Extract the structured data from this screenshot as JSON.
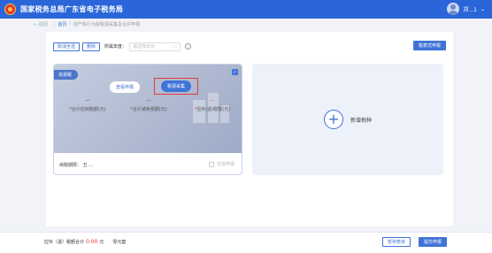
{
  "header": {
    "title": "国家税务总局广东省电子税务局",
    "user_name": "郑...1"
  },
  "breadcrumb": {
    "back": "← 返回",
    "home": "首页",
    "current": "财产和行为税税源采集及合并申报"
  },
  "toolbar": {
    "cancel_all": "取消全选",
    "delete": "删除",
    "period_label": "所属年度：",
    "period_placeholder": "请选择年份",
    "filing_button": "税表式申报"
  },
  "source_card": {
    "tag": "资源税",
    "view_button": "查看申报",
    "collect_button": "税源采集",
    "metrics": [
      {
        "value": "--",
        "label": "*合计应纳税额(元)",
        "red": false
      },
      {
        "value": "--",
        "label": "*合计减免税额(元)",
        "red": false
      },
      {
        "value": "--",
        "label": "应补(退)税额(元)",
        "red": true
      }
    ],
    "period_text": "纳税期限：  五 ...",
    "no_declare": "无需申报"
  },
  "add_card": {
    "label": "新增税种"
  },
  "footer": {
    "total_label": "应补（退）税额合计",
    "total_amount": "0.00",
    "unit": "元",
    "tax_text": "零元套",
    "draft_button": "暂存表单",
    "submit_button": "提交申报"
  }
}
